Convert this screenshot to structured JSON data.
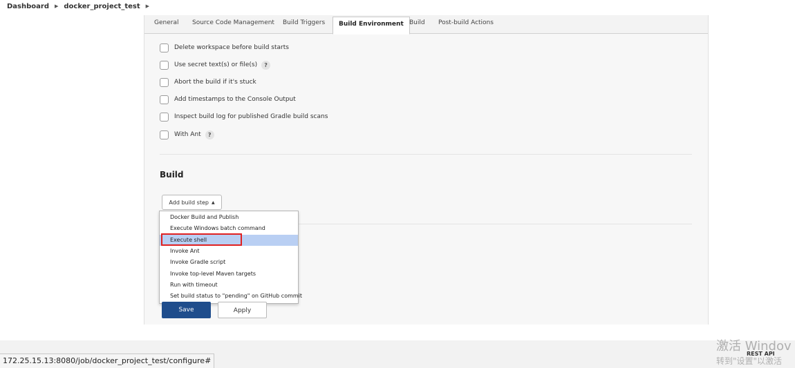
{
  "breadcrumb": {
    "items": [
      "Dashboard",
      "docker_project_test"
    ]
  },
  "tabs": [
    "General",
    "Source Code Management",
    "Build Triggers",
    "Build Environment",
    "Build",
    "Post-build Actions"
  ],
  "active_tab": "Build Environment",
  "build_environment": {
    "options": [
      {
        "label": "Delete workspace before build starts",
        "checked": false
      },
      {
        "label": "Use secret text(s) or file(s)",
        "checked": false,
        "help": "?"
      },
      {
        "label": "Abort the build if it's stuck",
        "checked": false
      },
      {
        "label": "Add timestamps to the Console Output",
        "checked": false
      },
      {
        "label": "Inspect build log for published Gradle build scans",
        "checked": false
      },
      {
        "label": "With Ant",
        "checked": false,
        "help": "?"
      }
    ]
  },
  "build": {
    "title": "Build",
    "add_step_label": "Add build step",
    "add_step_caret": "▲",
    "menu_items": [
      "Docker Build and Publish",
      "Execute Windows batch command",
      "Execute shell",
      "Invoke Ant",
      "Invoke Gradle script",
      "Invoke top-level Maven targets",
      "Run with timeout",
      "Set build status to \"pending\" on GitHub commit"
    ],
    "highlighted_item": "Execute shell"
  },
  "buttons": {
    "save": "Save",
    "apply": "Apply"
  },
  "footer": {
    "status_url": "172.25.15.13:8080/job/docker_project_test/configure#",
    "rest_api": "REST API",
    "watermark_line1": "激活 Windov",
    "watermark_line2": "转到\"设置\"以激活"
  },
  "colors": {
    "save_button": "#1f4d8c",
    "menu_highlight": "#b9cff3",
    "annotation_box": "#e02020"
  }
}
